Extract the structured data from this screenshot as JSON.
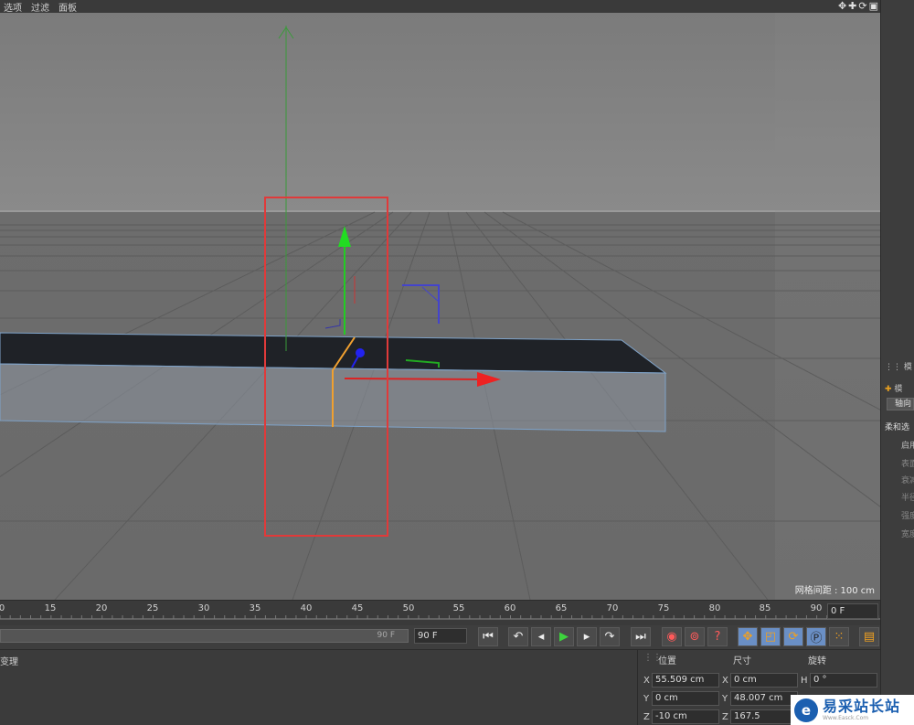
{
  "menu": {
    "items": [
      "选项",
      "过滤",
      "面板"
    ],
    "right_icons": [
      "✥",
      "✚",
      "⟳",
      "▣"
    ]
  },
  "viewport": {
    "grid_spacing_label": "网格间距 : 100 cm"
  },
  "timeline": {
    "ticks": [
      "0",
      "15",
      "20",
      "25",
      "30",
      "35",
      "40",
      "45",
      "50",
      "55",
      "60",
      "65",
      "70",
      "75",
      "80",
      "85",
      "90"
    ],
    "current_frame": "0 F"
  },
  "transport": {
    "range_end_label": "90 F",
    "end_frame": "90 F"
  },
  "bottom": {
    "tab_label": "变理"
  },
  "coords": {
    "pos_header": "位置",
    "size_header": "尺寸",
    "rot_header": "旋转",
    "x_axis": "X",
    "y_axis": "Y",
    "z_axis": "Z",
    "h_axis": "H",
    "pos_x": "55.509 cm",
    "pos_y": "0 cm",
    "pos_z": "-10 cm",
    "size_x": "0 cm",
    "size_y": "48.007 cm",
    "size_z": "167.5",
    "rot_h": "0 °"
  },
  "right_panel": {
    "items": [
      "模",
      "模",
      "轴向",
      "柔和选",
      "启用",
      "表面",
      "衰减",
      "半径",
      "强度",
      "宽度"
    ]
  },
  "watermark": {
    "brand": "易采站长站",
    "url": "Www.Easck.Com"
  }
}
